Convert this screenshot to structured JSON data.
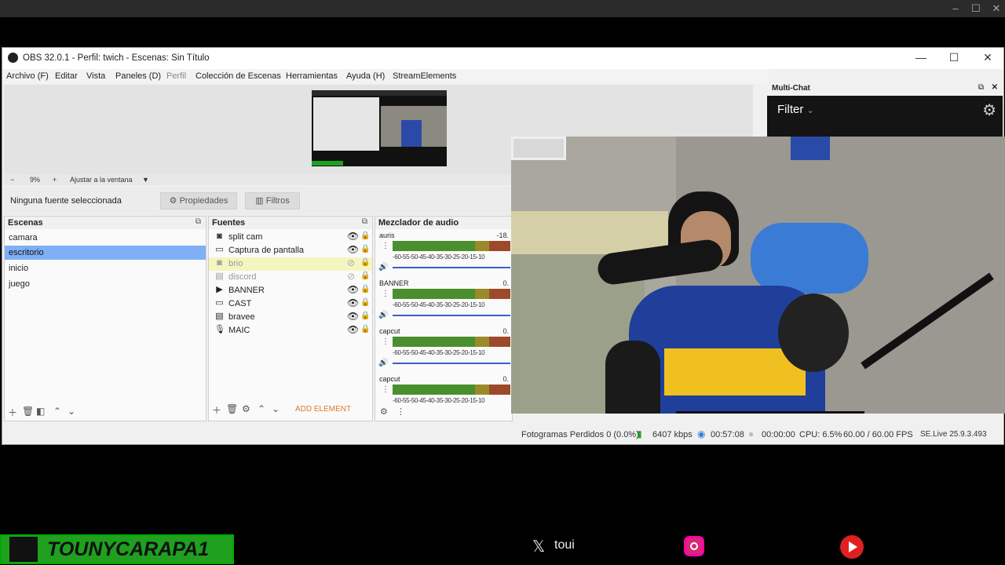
{
  "window": {
    "title": "OBS 32.0.1 - Perfil: twich - Escenas: Sin Título",
    "minimize": "—",
    "maximize": "☐",
    "close": "✕"
  },
  "menu": [
    "Archivo (F)",
    "Editar",
    "Vista",
    "Paneles (D)",
    "Perfil",
    "Colección de Escenas",
    "Herramientas",
    "Ayuda (H)",
    "StreamElements"
  ],
  "zoom": {
    "minus": "−",
    "value": "9%",
    "plus": "+",
    "fit": "Ajustar a la ventana"
  },
  "context": {
    "no_source": "Ninguna fuente seleccionada",
    "properties": "Propiedades",
    "filters": "Filtros"
  },
  "scenes": {
    "title": "Escenas",
    "items": [
      "camara",
      "escritorio",
      "inicio",
      "juego"
    ],
    "selected": "escritorio"
  },
  "sources": {
    "title": "Fuentes",
    "items": [
      {
        "label": "split cam",
        "icon": "camera-icon",
        "glyph": "◙"
      },
      {
        "label": "Captura de pantalla",
        "icon": "monitor-icon",
        "glyph": "▭"
      },
      {
        "label": "brio",
        "icon": "camera-icon",
        "glyph": "◙"
      },
      {
        "label": "discord",
        "icon": "window-icon",
        "glyph": "▤"
      },
      {
        "label": "BANNER",
        "icon": "play-icon",
        "glyph": "▶"
      },
      {
        "label": "CAST",
        "icon": "monitor-icon",
        "glyph": "▭"
      },
      {
        "label": "bravee",
        "icon": "window-icon",
        "glyph": "▤"
      },
      {
        "label": "MAIC",
        "icon": "microphone-icon",
        "glyph": "🎙"
      }
    ],
    "add_element": "ADD ELEMENT"
  },
  "mixer": {
    "title": "Mezclador de audio",
    "channels": [
      {
        "name": "auris",
        "db": "-18."
      },
      {
        "name": "BANNER",
        "db": "0."
      },
      {
        "name": "capcut",
        "db": "0."
      },
      {
        "name": "capcut",
        "db": "0."
      }
    ],
    "scale": "-60-55-50-45-40-35-30-25-20-15-10"
  },
  "status": {
    "dropped": "Fotogramas Perdidos 0 (0.0%)",
    "kbps": "6407 kbps",
    "stream_time": "00:57:08",
    "rec_time": "00:00:00",
    "cpu": "CPU: 6.5%",
    "fps": "60.00 / 60.00 FPS",
    "se_live": "SE.Live 25.9.3.493"
  },
  "multichat": {
    "title": "Multi-Chat",
    "filter": "Filter"
  },
  "overlay": {
    "banner_name": "TOUNYCARAPA1",
    "x_handle": "toui"
  },
  "colors": {
    "selection": "#7fb0f5",
    "highlight_row": "#f5f5c0",
    "banner_green": "#1fa01f",
    "accent_orange": "#e07b2a"
  }
}
